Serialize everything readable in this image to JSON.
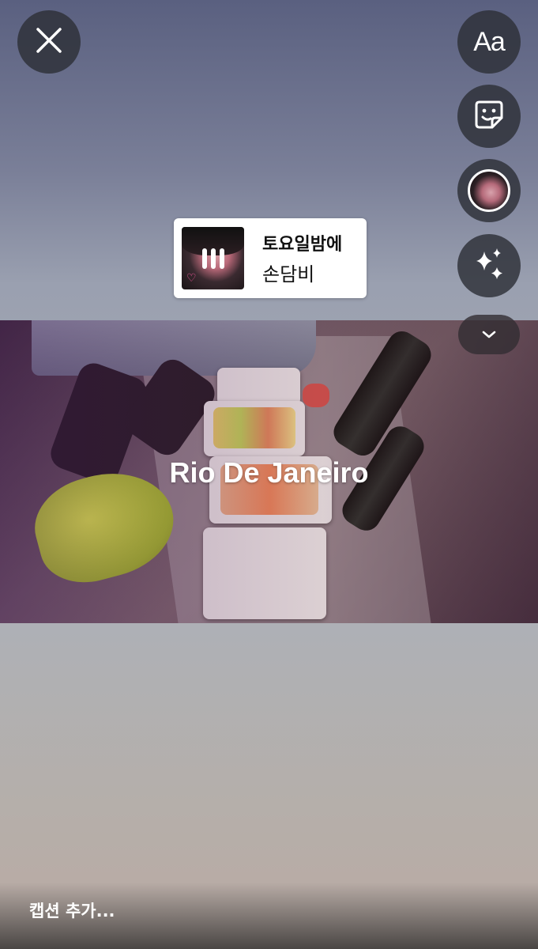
{
  "toolbar": {
    "close_icon": "close-icon",
    "text_button_label": "Aa",
    "sticker_icon": "sticker-icon",
    "avatar_icon": "profile-avatar",
    "effects_icon": "sparkles-icon",
    "more_icon": "chevron-down-icon"
  },
  "music_sticker": {
    "title": "토요일밤에",
    "artist": "손담비",
    "cover_text": "♡",
    "state_icon": "pause-icon"
  },
  "story": {
    "location_text": "Rio De Janeiro"
  },
  "caption": {
    "placeholder": "캡션 추가..."
  },
  "colors": {
    "button_bg": "#2d2f37",
    "sticker_bg": "#ffffff"
  }
}
